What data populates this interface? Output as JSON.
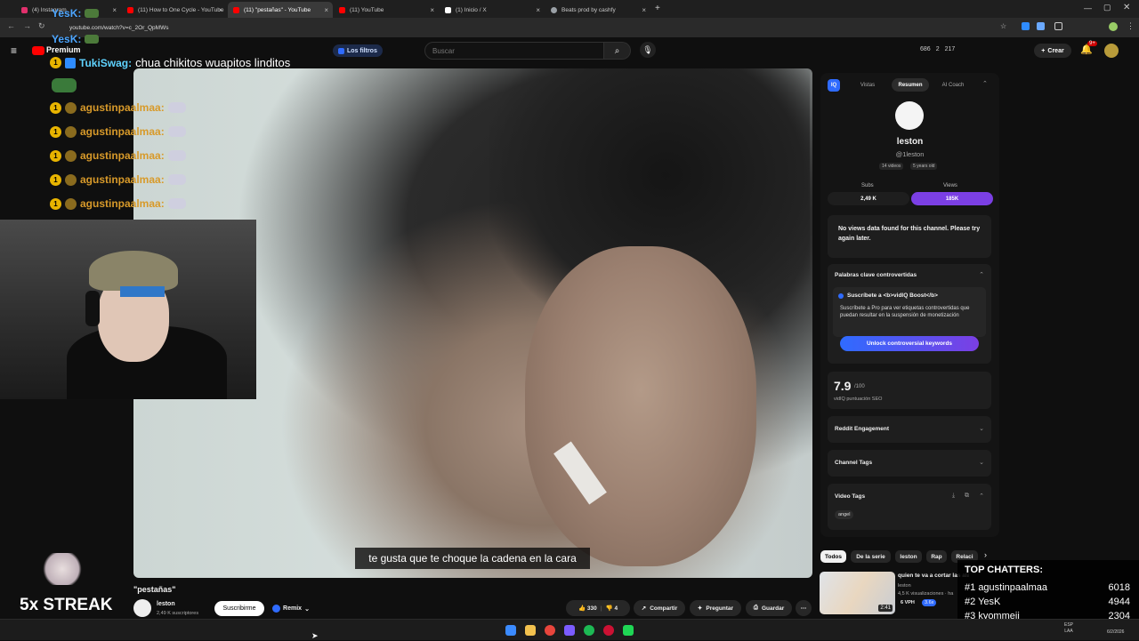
{
  "tabs": [
    {
      "label": "(4) Instagram",
      "color": "#e1306c"
    },
    {
      "label": "(11) How to One Cycle - YouTube",
      "color": "#ff0000"
    },
    {
      "label": "(11) \"pestañas\" - YouTube",
      "color": "#ff0000"
    },
    {
      "label": "(11) YouTube",
      "color": "#ff0000"
    },
    {
      "label": "(1) Inicio / X",
      "color": "#ffffff"
    },
    {
      "label": "Beats prod by cashfy",
      "color": "#9aa0a6"
    }
  ],
  "address": {
    "url": "youtube.com/watch?v=c_2Or_QpMWs"
  },
  "header": {
    "premium_label": "Premium",
    "filters_label": "Los filtros",
    "search_placeholder": "Buscar",
    "stat1": "686",
    "stat2": "2",
    "stat3": "217",
    "create_label": "Crear",
    "notif_count": "9+"
  },
  "chat": {
    "top_user1": "YesK:",
    "top_user2": "YesK:",
    "line_user": "TukiSwag:",
    "line_msg": "chua chikitos wuapitos linditos",
    "repeat_user": "agustinpaalmaa:",
    "repeat_count": 5
  },
  "video": {
    "caption": "te gusta que te choque la cadena en la cara",
    "title": "\"pestañas\""
  },
  "channel": {
    "name": "leston",
    "subs": "2,49 K suscriptores",
    "subscribe_label": "Suscribirme",
    "remix_label": "Remix"
  },
  "actions": {
    "likes": "330",
    "dislikes": "4",
    "share": "Compartir",
    "ask": "Preguntar",
    "save": "Guardar"
  },
  "panel": {
    "logo": "IQ",
    "tabs": [
      "Vistas",
      "Resumen",
      "AI Coach"
    ],
    "channel_name": "leston",
    "handle": "@1leston",
    "videos": "14 videos",
    "age": "5 years old",
    "subs_label": "Subs",
    "subs_value": "2,49 K",
    "views_label": "Views",
    "views_value": "185K",
    "no_data": "No views data found for this channel. Please try again later.",
    "keywords_title": "Palabras clave controvertidas",
    "boost_title": "Suscríbete a <b>vidIQ Boost</b>",
    "boost_desc": "Suscríbete a Pro para ver etiquetas controvertidas que puedan resultar en la suspensión de monetización",
    "unlock_label": "Unlock controversial keywords",
    "seo_score": "7.9",
    "seo_max": "/100",
    "seo_label": "vidIQ puntuación SEO",
    "reddit_title": "Reddit Engagement",
    "channel_tags_title": "Channel Tags",
    "video_tags_title": "Video Tags",
    "tag": "angel"
  },
  "chips": [
    "Todos",
    "De la serie",
    "leston",
    "Rap",
    "Relaci"
  ],
  "reco": {
    "title": "quien te va a cortar las alas",
    "channel": "leston",
    "views": "4,5 K visualizaciones · ha",
    "vph": "6 VPH",
    "multiplier": "3.6x",
    "duration": "2:41"
  },
  "streak": {
    "label": "5x STREAK"
  },
  "chatters": {
    "title": "TOP CHATTERS:",
    "rows": [
      {
        "rank": "#1",
        "name": "agustinpaalmaa",
        "count": "6018"
      },
      {
        "rank": "#2",
        "name": "YesK",
        "count": "4944"
      },
      {
        "rank": "#3",
        "name": "kyommeii",
        "count": "2304"
      }
    ]
  },
  "taskbar": {
    "lang": "ESP",
    "layout": "LAA",
    "date": "6/2/2026"
  },
  "colors": {
    "accent_purple": "#7b3fe4",
    "unlock_blue": "#2f6bff",
    "yt_red": "#ff0000"
  }
}
